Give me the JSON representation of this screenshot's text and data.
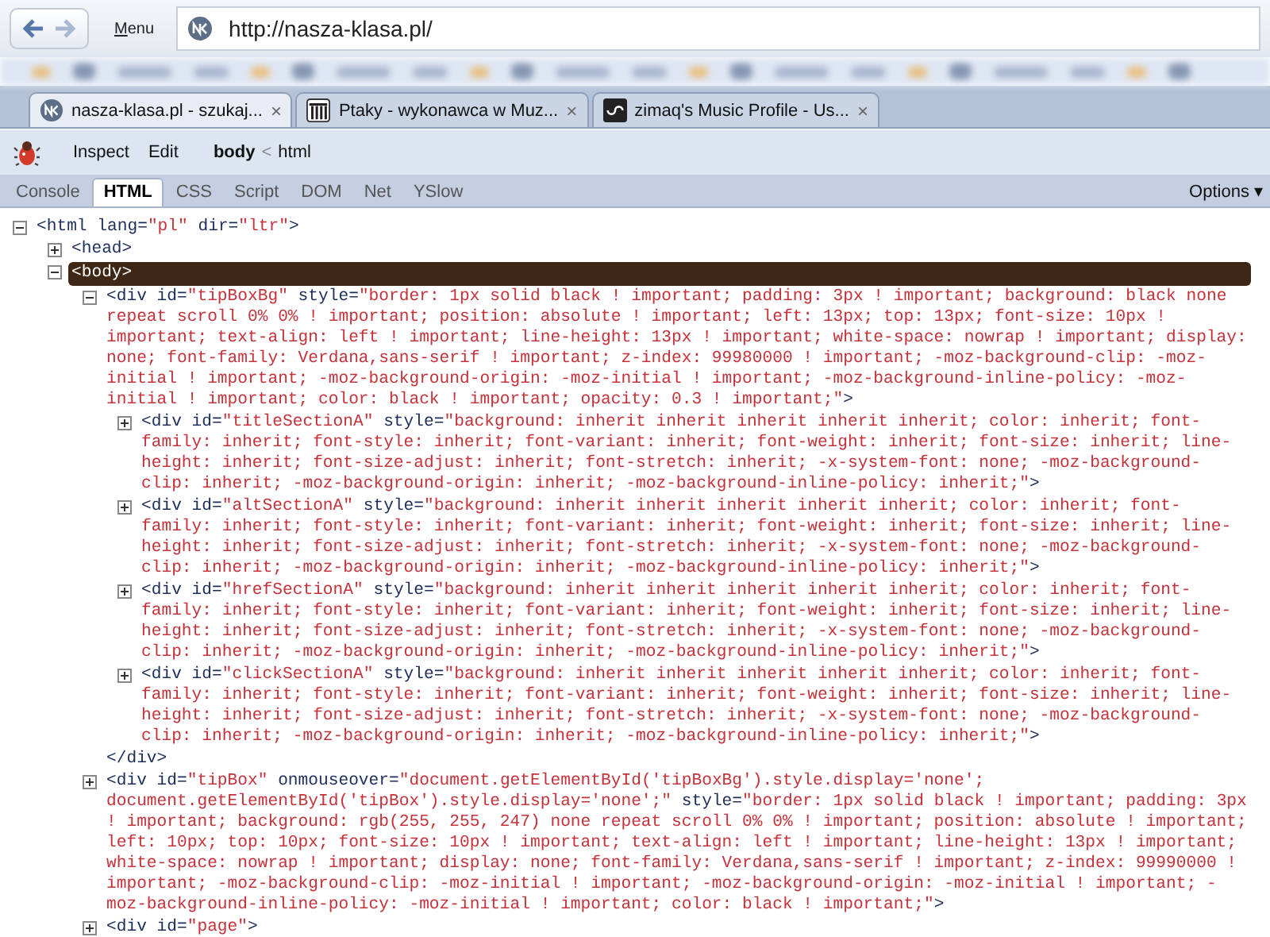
{
  "browser": {
    "menu_label": "Menu",
    "address": "http://nasza-klasa.pl/"
  },
  "tabs": [
    {
      "title": "nasza-klasa.pl - szukaj...",
      "close": "×",
      "selected": true,
      "kind": "nk"
    },
    {
      "title": "Ptaky - wykonawca w Muz...",
      "close": "×",
      "selected": false,
      "kind": "columns"
    },
    {
      "title": "zimaq's Music Profile - Us...",
      "close": "×",
      "selected": false,
      "kind": "lastfm"
    }
  ],
  "firebug": {
    "actions": [
      "Inspect",
      "Edit"
    ],
    "breadcrumb": [
      {
        "label": "body",
        "selected": true
      },
      {
        "label": "html",
        "selected": false
      }
    ],
    "breadcrumb_separator": "<",
    "panels": [
      {
        "label": "Console",
        "selected": false
      },
      {
        "label": "HTML",
        "selected": true
      },
      {
        "label": "CSS",
        "selected": false
      },
      {
        "label": "Script",
        "selected": false
      },
      {
        "label": "DOM",
        "selected": false
      },
      {
        "label": "Net",
        "selected": false
      },
      {
        "label": "YSlow",
        "selected": false
      }
    ],
    "options": "Options ▾"
  },
  "tree": [
    {
      "segments": [
        {
          "kind": "markup",
          "text": "<html lang="
        },
        {
          "kind": "value",
          "text": "\"pl\""
        },
        {
          "kind": "markup",
          "text": " dir="
        },
        {
          "kind": "value",
          "text": "\"ltr\""
        },
        {
          "kind": "markup",
          "text": ">"
        }
      ],
      "expanded": true,
      "selected": false,
      "children": [
        {
          "segments": [
            {
              "kind": "markup",
              "text": "<head>"
            }
          ],
          "expanded": false,
          "selected": false
        },
        {
          "segments": [
            {
              "kind": "markup",
              "text": "<body>"
            }
          ],
          "expanded": true,
          "selected": true,
          "children": [
            {
              "segments": [
                {
                  "kind": "markup",
                  "text": "<div id="
                },
                {
                  "kind": "value",
                  "text": "\"tipBoxBg\""
                },
                {
                  "kind": "markup",
                  "text": " style="
                },
                {
                  "kind": "value",
                  "text": "\"border: 1px solid black ! important; padding: 3px ! important; background: black none repeat scroll 0% 0% ! important; position: absolute ! important; left: 13px; top: 13px; font-size: 10px ! important; text-align: left ! important; line-height: 13px ! important; white-space: nowrap ! important; display: none; font-family: Verdana,sans-serif ! important; z-index: 99980000 ! important; -moz-background-clip: -moz-initial ! important; -moz-background-origin: -moz-initial ! important; -moz-background-inline-policy: -moz-initial ! important; color: black ! important; opacity: 0.3 ! important;\""
                },
                {
                  "kind": "markup",
                  "text": ">"
                }
              ],
              "expanded": true,
              "selected": false,
              "close": "</div>",
              "children": [
                {
                  "segments": [
                    {
                      "kind": "markup",
                      "text": "<div id="
                    },
                    {
                      "kind": "value",
                      "text": "\"titleSectionA\""
                    },
                    {
                      "kind": "markup",
                      "text": " style="
                    },
                    {
                      "kind": "value",
                      "text": "\"background: inherit inherit inherit inherit inherit; color: inherit; font-family: inherit; font-style: inherit; font-variant: inherit; font-weight: inherit; font-size: inherit; line-height: inherit; font-size-adjust: inherit; font-stretch: inherit; -x-system-font: none; -moz-background-clip: inherit; -moz-background-origin: inherit; -moz-background-inline-policy: inherit;\""
                    },
                    {
                      "kind": "markup",
                      "text": ">"
                    }
                  ],
                  "expanded": false,
                  "selected": false
                },
                {
                  "segments": [
                    {
                      "kind": "markup",
                      "text": "<div id="
                    },
                    {
                      "kind": "value",
                      "text": "\"altSectionA\""
                    },
                    {
                      "kind": "markup",
                      "text": " style="
                    },
                    {
                      "kind": "value",
                      "text": "\"background: inherit inherit inherit inherit inherit; color: inherit; font-family: inherit; font-style: inherit; font-variant: inherit; font-weight: inherit; font-size: inherit; line-height: inherit; font-size-adjust: inherit; font-stretch: inherit; -x-system-font: none; -moz-background-clip: inherit; -moz-background-origin: inherit; -moz-background-inline-policy: inherit;\""
                    },
                    {
                      "kind": "markup",
                      "text": ">"
                    }
                  ],
                  "expanded": false,
                  "selected": false
                },
                {
                  "segments": [
                    {
                      "kind": "markup",
                      "text": "<div id="
                    },
                    {
                      "kind": "value",
                      "text": "\"hrefSectionA\""
                    },
                    {
                      "kind": "markup",
                      "text": " style="
                    },
                    {
                      "kind": "value",
                      "text": "\"background: inherit inherit inherit inherit inherit; color: inherit; font-family: inherit; font-style: inherit; font-variant: inherit; font-weight: inherit; font-size: inherit; line-height: inherit; font-size-adjust: inherit; font-stretch: inherit; -x-system-font: none; -moz-background-clip: inherit; -moz-background-origin: inherit; -moz-background-inline-policy: inherit;\""
                    },
                    {
                      "kind": "markup",
                      "text": ">"
                    }
                  ],
                  "expanded": false,
                  "selected": false
                },
                {
                  "segments": [
                    {
                      "kind": "markup",
                      "text": "<div id="
                    },
                    {
                      "kind": "value",
                      "text": "\"clickSectionA\""
                    },
                    {
                      "kind": "markup",
                      "text": " style="
                    },
                    {
                      "kind": "value",
                      "text": "\"background: inherit inherit inherit inherit inherit; color: inherit; font-family: inherit; font-style: inherit; font-variant: inherit; font-weight: inherit; font-size: inherit; line-height: inherit; font-size-adjust: inherit; font-stretch: inherit; -x-system-font: none; -moz-background-clip: inherit; -moz-background-origin: inherit; -moz-background-inline-policy: inherit;\""
                    },
                    {
                      "kind": "markup",
                      "text": ">"
                    }
                  ],
                  "expanded": false,
                  "selected": false
                }
              ]
            },
            {
              "segments": [
                {
                  "kind": "markup",
                  "text": "<div id="
                },
                {
                  "kind": "value",
                  "text": "\"tipBox\""
                },
                {
                  "kind": "markup",
                  "text": " onmouseover="
                },
                {
                  "kind": "value",
                  "text": "\"document.getElementById('tipBoxBg').style.display='none'; document.getElementById('tipBox').style.display='none';\""
                },
                {
                  "kind": "markup",
                  "text": " style="
                },
                {
                  "kind": "value",
                  "text": "\"border: 1px solid black ! important; padding: 3px ! important; background: rgb(255, 255, 247) none repeat scroll 0% 0% ! important; position: absolute ! important; left: 10px; top: 10px; font-size: 10px ! important; text-align: left ! important; line-height: 13px ! important; white-space: nowrap ! important; display: none; font-family: Verdana,sans-serif ! important; z-index: 99990000 ! important; -moz-background-clip: -moz-initial ! important; -moz-background-origin: -moz-initial ! important; -moz-background-inline-policy: -moz-initial ! important; color: black ! important;\""
                },
                {
                  "kind": "markup",
                  "text": ">"
                }
              ],
              "expanded": false,
              "selected": false
            },
            {
              "segments": [
                {
                  "kind": "markup",
                  "text": "<div id="
                },
                {
                  "kind": "value",
                  "text": "\"page\""
                },
                {
                  "kind": "markup",
                  "text": ">"
                }
              ],
              "expanded": false,
              "selected": false
            }
          ]
        }
      ]
    }
  ]
}
